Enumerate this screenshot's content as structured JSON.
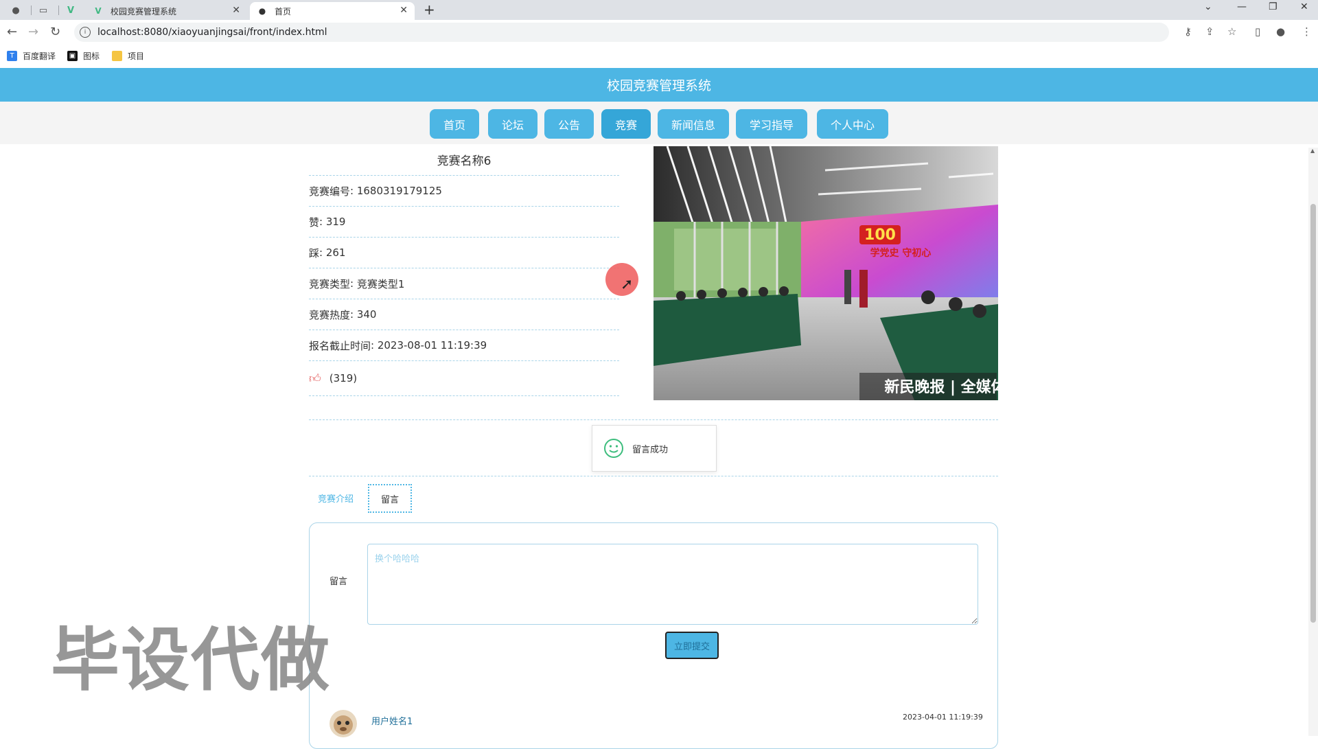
{
  "browser": {
    "tabs": [
      {
        "title": "校园竞赛管理系统",
        "active": false
      },
      {
        "title": "首页",
        "active": true
      }
    ],
    "url": "localhost:8080/xiaoyuanjingsai/front/index.html",
    "bookmarks": [
      {
        "label": "百度翻译",
        "icon": "translate-icon"
      },
      {
        "label": "图标",
        "icon": "image-icon"
      },
      {
        "label": "项目",
        "icon": "folder-icon"
      }
    ]
  },
  "site": {
    "title": "校园竞赛管理系统",
    "nav": [
      "首页",
      "论坛",
      "公告",
      "竞赛",
      "新闻信息",
      "学习指导",
      "个人中心"
    ],
    "active_nav": "竞赛"
  },
  "competition": {
    "name": "竞赛名称6",
    "fields": [
      {
        "label": "竞赛编号",
        "value": "1680319179125"
      },
      {
        "label": "赞",
        "value": "319"
      },
      {
        "label": "踩",
        "value": "261"
      },
      {
        "label": "竞赛类型",
        "value": "竞赛类型1"
      },
      {
        "label": "竞赛热度",
        "value": "340"
      },
      {
        "label": "报名截止时间",
        "value": "2023-08-01 11:19:39"
      }
    ],
    "like_count": "(319)",
    "image_caption": "新民晚报 | 全媒体",
    "image_banner": "学党史 守初心",
    "image_logo": "100"
  },
  "toast": {
    "message": "留言成功"
  },
  "tabs": {
    "intro": "竞赛介绍",
    "comment": "留言"
  },
  "comment_form": {
    "label": "留言",
    "placeholder": "换个哈哈哈",
    "submit": "立即提交"
  },
  "comments": [
    {
      "user": "用户姓名1",
      "time": "2023-04-01 11:19:39"
    }
  ],
  "watermark": "毕设代做",
  "colors": {
    "primary": "#4db6e4",
    "active": "#35a6d8",
    "dashed": "#a9d4e8",
    "like": "#e35b5b"
  }
}
